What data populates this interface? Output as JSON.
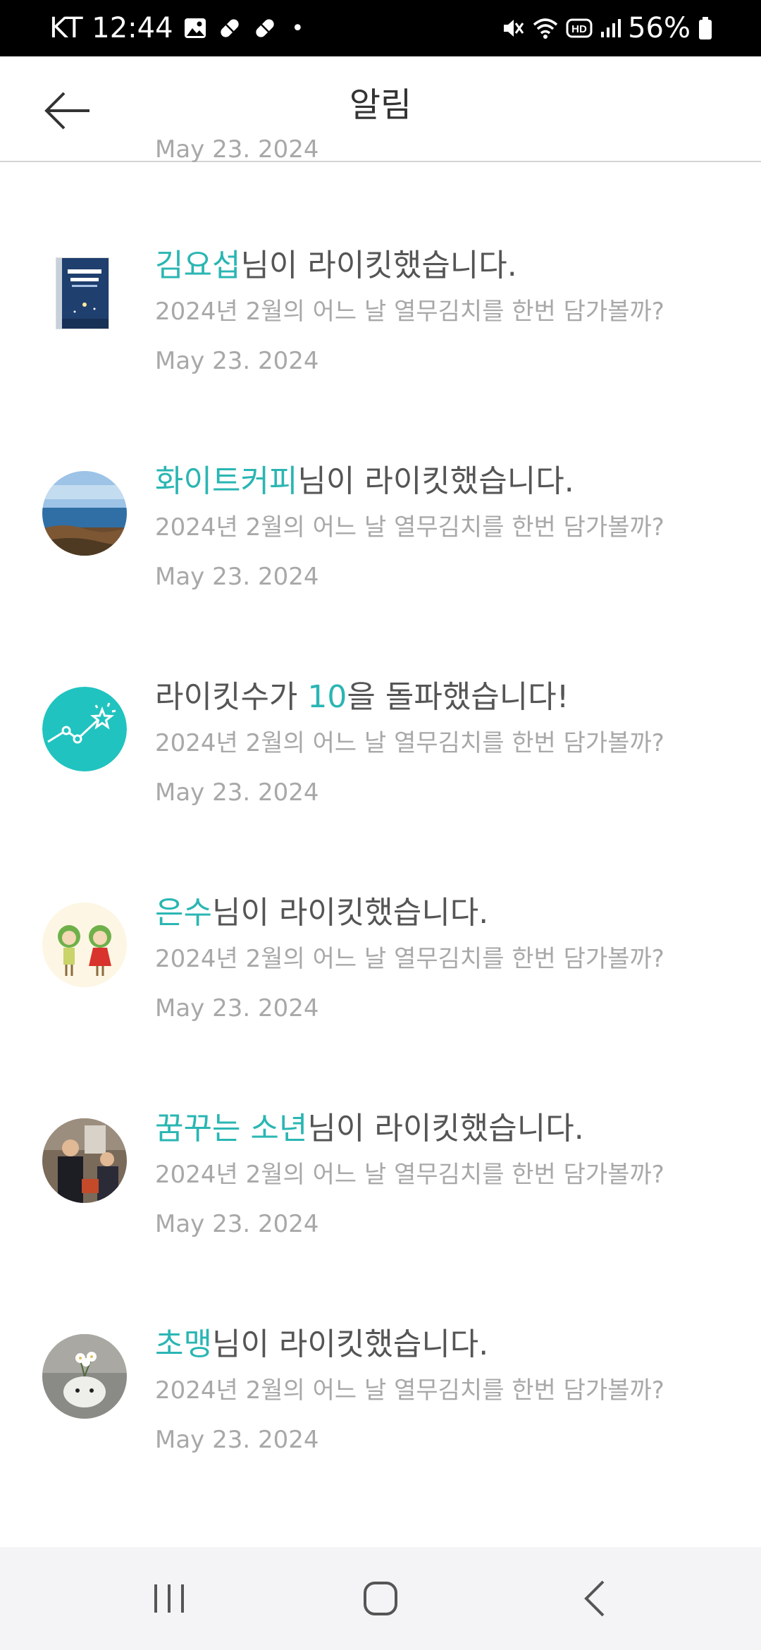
{
  "status_bar": {
    "carrier_time": "KT 12:44",
    "dot": "•",
    "battery": "56%",
    "icons": [
      "image-icon",
      "pill-icon",
      "pill-icon",
      "mute-icon",
      "wifi-icon",
      "hd-icon",
      "signal-icon",
      "battery-icon"
    ]
  },
  "header": {
    "title": "알림",
    "back_icon": "arrow-left-icon"
  },
  "partial_top_date": "May 23. 2024",
  "notifications": [
    {
      "avatar": "book-cover-thumbnail",
      "highlight": "김요섭",
      "rest": "님이 라이킷했습니다.",
      "subtitle": "2024년 2월의 어느 날 열무김치를 한번 담가볼까?",
      "date": "May 23. 2024"
    },
    {
      "avatar": "seaside-landscape-thumbnail",
      "highlight": "화이트커피",
      "rest": "님이 라이킷했습니다.",
      "subtitle": "2024년 2월의 어느 날 열무김치를 한번 담가볼까?",
      "date": "May 23. 2024"
    },
    {
      "avatar": "milestone-star-graph-icon",
      "prefix": "라이킷수가 ",
      "highlight": "10",
      "rest": "을 돌파했습니다!",
      "subtitle": "2024년 2월의 어느 날 열무김치를 한번 담가볼까?",
      "date": "May 23. 2024"
    },
    {
      "avatar": "cartoon-couple-thumbnail",
      "highlight": "은수",
      "rest": "님이 라이킷했습니다.",
      "subtitle": "2024년 2월의 어느 날 열무김치를 한번 담가볼까?",
      "date": "May 23. 2024"
    },
    {
      "avatar": "people-photo-thumbnail",
      "highlight": "꿈꾸는 소년",
      "rest": "님이 라이킷했습니다.",
      "subtitle": "2024년 2월의 어느 날 열무김치를 한번 담가볼까?",
      "date": "May 23. 2024"
    },
    {
      "avatar": "flower-vase-thumbnail",
      "highlight": "초맹",
      "rest": "님이 라이킷했습니다.",
      "subtitle": "2024년 2월의 어느 날 열무김치를 한번 담가볼까?",
      "date": "May 23. 2024"
    }
  ],
  "nav_bar": {
    "buttons": [
      "recent-apps-icon",
      "home-icon",
      "back-chevron-icon"
    ]
  },
  "colors": {
    "accent": "#2ab6b3",
    "title_text": "#555555",
    "secondary_text": "#a8a8a8",
    "divider": "#d4d4d4",
    "nav_bg": "#f4f4f6"
  }
}
